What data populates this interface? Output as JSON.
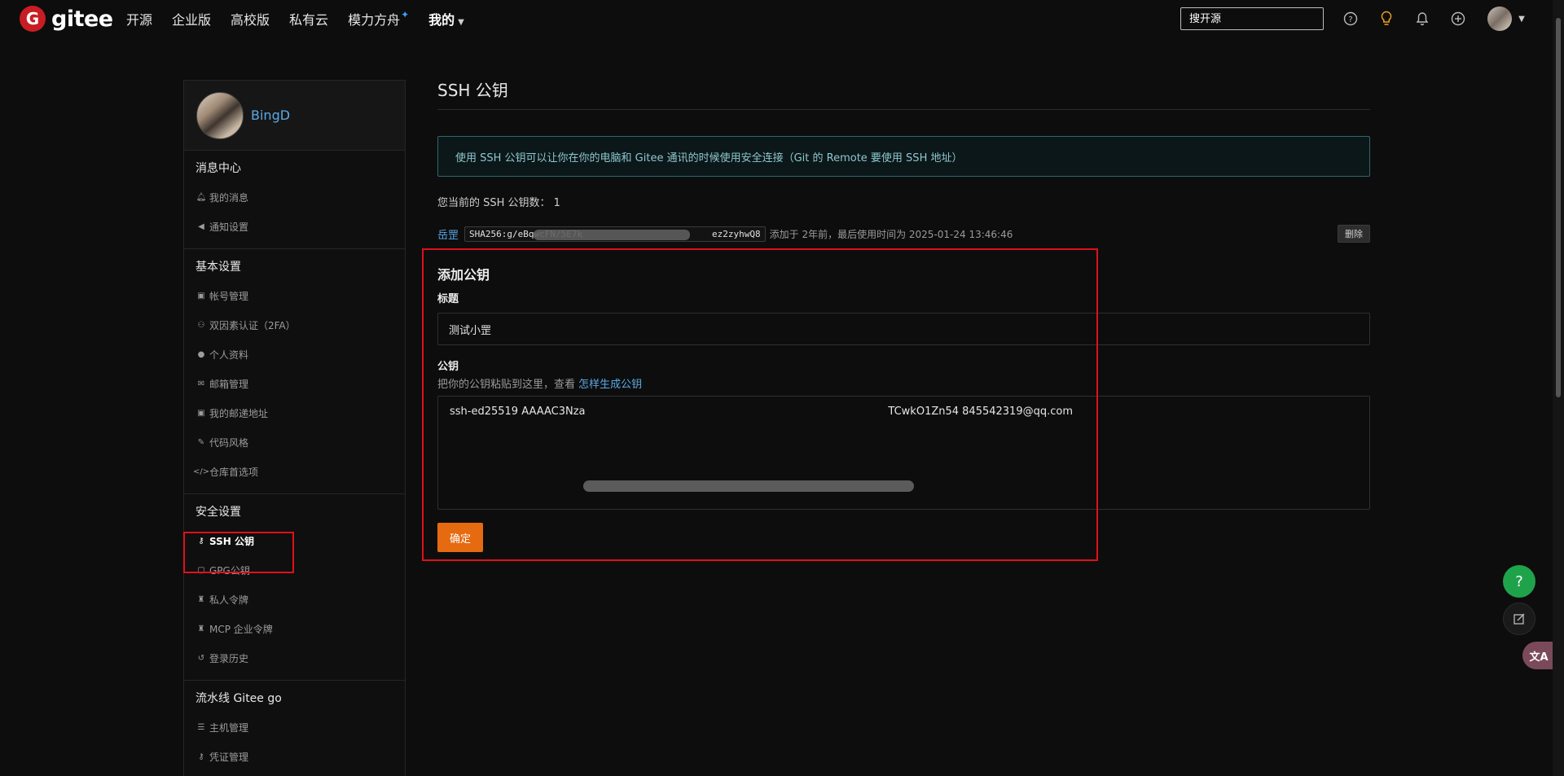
{
  "header": {
    "logo_text": "gitee",
    "logo_mark": "G",
    "nav": [
      "开源",
      "企业版",
      "高校版",
      "私有云",
      "模力方舟",
      "我的"
    ],
    "search_placeholder": "搜开源"
  },
  "sidebar": {
    "username": "BingD",
    "groups": [
      {
        "title": "消息中心",
        "items": [
          {
            "label": "我的消息",
            "icon": "bell-icon"
          },
          {
            "label": "通知设置",
            "icon": "speaker-icon"
          }
        ]
      },
      {
        "title": "基本设置",
        "items": [
          {
            "label": "帐号管理",
            "icon": "id-card-icon"
          },
          {
            "label": "双因素认证（2FA）",
            "icon": "user-shield-icon"
          },
          {
            "label": "个人资料",
            "icon": "user-icon"
          },
          {
            "label": "邮箱管理",
            "icon": "envelope-icon"
          },
          {
            "label": "我的邮递地址",
            "icon": "address-card-icon"
          },
          {
            "label": "代码风格",
            "icon": "brush-icon"
          },
          {
            "label": "仓库首选项",
            "icon": "code-icon"
          }
        ]
      },
      {
        "title": "安全设置",
        "items": [
          {
            "label": "SSH 公钥",
            "icon": "key-icon",
            "active": true
          },
          {
            "label": "GPG公钥",
            "icon": "lock-icon"
          },
          {
            "label": "私人令牌",
            "icon": "token-icon"
          },
          {
            "label": "MCP 企业令牌",
            "icon": "token-icon"
          },
          {
            "label": "登录历史",
            "icon": "history-icon"
          }
        ]
      },
      {
        "title": "流水线 Gitee go",
        "items": [
          {
            "label": "主机管理",
            "icon": "server-icon"
          },
          {
            "label": "凭证管理",
            "icon": "key-icon"
          }
        ]
      }
    ]
  },
  "main": {
    "title": "SSH 公钥",
    "notice": "使用 SSH 公钥可以让你在你的电脑和 Gitee 通讯的时候使用安全连接（Git 的 Remote 要使用 SSH 地址）",
    "key_count_text": "您当前的 SSH 公钥数： 1",
    "key": {
      "name": "岳罡",
      "fingerprint": "SHA256:g/eBqwcFN/5E7k                        ez2zyhwQ8",
      "meta": "添加于 2年前，最后使用时间为 2025-01-24 13:46:46",
      "delete_label": "删除"
    },
    "add": {
      "title": "添加公钥",
      "title_label": "标题",
      "title_value": "测试小罡",
      "key_label": "公钥",
      "hint": "把你的公钥粘贴到这里，查看",
      "hint_link": "怎样生成公钥",
      "key_value": "ssh-ed25519 AAAAC3Nza                                                                                          TCwkO1Zn54 845542319@qq.com",
      "confirm_label": "确定"
    }
  },
  "colors": {
    "accent": "#e66a10",
    "link": "#5aa9e6",
    "brand": "#c71d23",
    "annotation": "#e0101a"
  }
}
